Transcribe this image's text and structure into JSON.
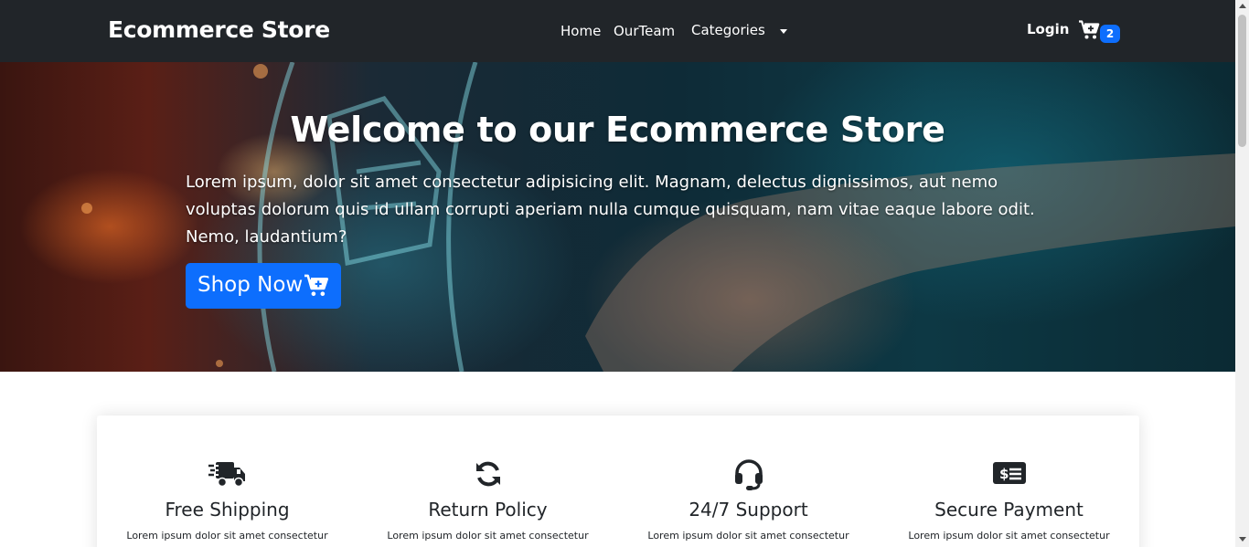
{
  "navbar": {
    "brand": "Ecommerce Store",
    "links": [
      {
        "label": "Home"
      },
      {
        "label": "OurTeam"
      },
      {
        "label": "Categories"
      }
    ],
    "login": "Login",
    "cart_count": "2",
    "background": "#212529"
  },
  "hero": {
    "title": "Welcome to our Ecommerce Store",
    "text": "Lorem ipsum, dolor sit amet consectetur adipisicing elit. Magnam, delectus dignissimos, aut nemo voluptas dolorum quis id ullam corrupti aperiam nulla cumque quisquam, nam vitae eaque labore odit. Nemo, laudantium?",
    "button": "Shop Now",
    "button_color": "#0d6efd"
  },
  "features": [
    {
      "icon": "truck-fast-icon",
      "title": "Free Shipping",
      "text": "Lorem ipsum dolor sit amet consectetur"
    },
    {
      "icon": "rotate-icon",
      "title": "Return Policy",
      "text": "Lorem ipsum dolor sit amet consectetur"
    },
    {
      "icon": "headset-icon",
      "title": "24/7 Support",
      "text": "Lorem ipsum dolor sit amet consectetur"
    },
    {
      "icon": "money-check-icon",
      "title": "Secure Payment",
      "text": "Lorem ipsum dolor sit amet consectetur"
    }
  ]
}
